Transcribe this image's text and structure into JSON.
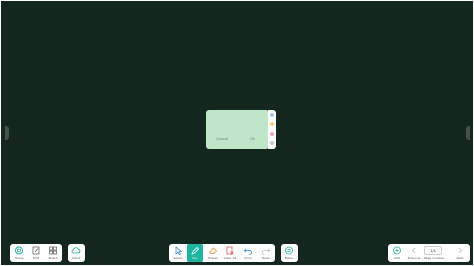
{
  "note": {
    "cancel_label": "Cancel",
    "ok_label": "Ok",
    "colors": [
      "#9ec8f0",
      "#f2d37a",
      "#f0a7b5",
      "#c9c9c9"
    ]
  },
  "left_panel": {
    "items": [
      {
        "label": "Home",
        "icon": "home-icon"
      },
      {
        "label": "Edit",
        "icon": "edit-icon"
      },
      {
        "label": "Board",
        "icon": "board-icon"
      }
    ]
  },
  "cloud_panel": {
    "label": "Cloud",
    "icon": "cloud-icon"
  },
  "center_panel": {
    "items": [
      {
        "label": "Select",
        "icon": "select-icon"
      },
      {
        "label": "Pen",
        "icon": "pen-icon",
        "active": true
      },
      {
        "label": "Eraser",
        "icon": "eraser-icon"
      },
      {
        "label": "Clear All",
        "icon": "clear-all-icon"
      },
      {
        "label": "Undo",
        "icon": "undo-icon"
      },
      {
        "label": "Redo",
        "icon": "redo-icon"
      }
    ]
  },
  "menu_panel": {
    "label": "Menu",
    "icon": "menu-icon"
  },
  "right_panel": {
    "add_label": "Add",
    "previous_label": "Previous",
    "page_value": "1/1",
    "page_number_label": "Page number",
    "next_label": "Next"
  },
  "colors": {
    "background": "#14271f",
    "accent": "#1db5a0",
    "note": "#bfe6c8"
  }
}
